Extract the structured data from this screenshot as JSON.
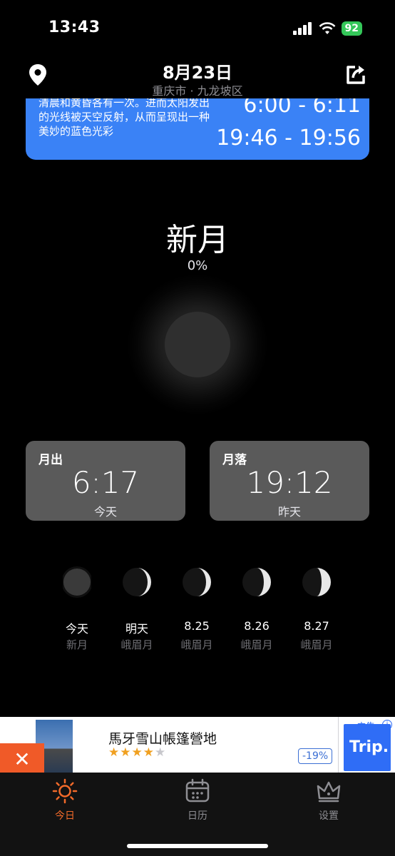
{
  "status": {
    "time": "13:43",
    "battery": "92"
  },
  "header": {
    "date": "8月23日",
    "location": "重庆市 · 九龙坡区"
  },
  "blue_hour": {
    "description": "清晨和黄昏各有一次。进而太阳发出的光线被天空反射，从而呈现出一种美妙的蓝色光彩",
    "morning": "6:00 - 6:11",
    "evening": "19:46 - 19:56"
  },
  "moon": {
    "phase": "新月",
    "illumination": "0%"
  },
  "moonrise": {
    "label": "月出",
    "time": "6:17",
    "day": "今天"
  },
  "moonset": {
    "label": "月落",
    "time": "19:12",
    "day": "昨天"
  },
  "forecast": [
    {
      "day": "今天",
      "phase": "新月",
      "icon": "new-moon-icon"
    },
    {
      "day": "明天",
      "phase": "峨眉月",
      "icon": "crescent-moon-icon"
    },
    {
      "day": "8.25",
      "phase": "峨眉月",
      "icon": "crescent-moon-icon"
    },
    {
      "day": "8.26",
      "phase": "峨眉月",
      "icon": "crescent-moon-icon"
    },
    {
      "day": "8.27",
      "phase": "峨眉月",
      "icon": "crescent-moon-icon"
    }
  ],
  "ad": {
    "title": "馬牙雪山帳篷營地",
    "rating": 4,
    "discount": "-19%",
    "brand": "Trip.",
    "tag": "广告",
    "close": "✕"
  },
  "tabs": [
    {
      "label": "今日",
      "icon": "sun-icon",
      "active": true
    },
    {
      "label": "日历",
      "icon": "calendar-icon",
      "active": false
    },
    {
      "label": "设置",
      "icon": "crown-icon",
      "active": false
    }
  ],
  "colors": {
    "accent": "#f26a2a",
    "blue_card": "#3a82f6",
    "card_bg": "#5a5a5a",
    "battery": "#34c759"
  }
}
